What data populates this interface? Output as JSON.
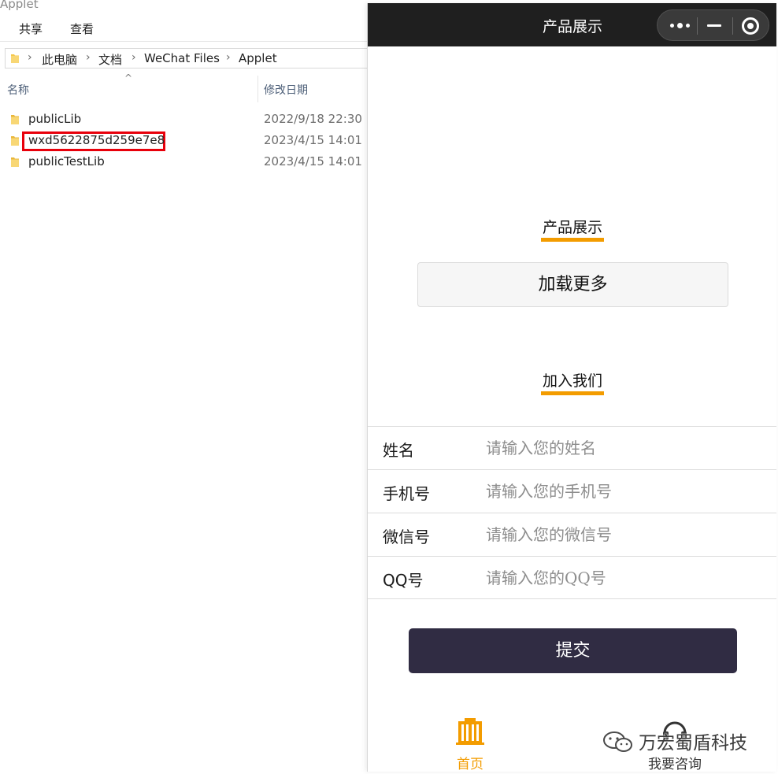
{
  "explorer": {
    "window_title": "Applet",
    "ribbon": [
      "共享",
      "查看"
    ],
    "breadcrumb": [
      "此电脑",
      "文档",
      "WeChat Files",
      "Applet"
    ],
    "columns": {
      "name": "名称",
      "date": "修改日期"
    },
    "files": [
      {
        "name": "publicLib",
        "date": "2022/9/18 22:30"
      },
      {
        "name": "wxd5622875d259e7e8",
        "date": "2023/4/15 14:01",
        "highlighted": true
      },
      {
        "name": "publicTestLib",
        "date": "2023/4/15 14:01"
      }
    ],
    "colors": {
      "folder": "#f5c84c",
      "highlight": "#e8000b"
    }
  },
  "miniapp": {
    "nav_title": "产品展示",
    "products_section": {
      "title": "产品展示",
      "load_more": "加载更多"
    },
    "join_section": {
      "title": "加入我们"
    },
    "form": [
      {
        "label": "姓名",
        "placeholder": "请输入您的姓名"
      },
      {
        "label": "手机号",
        "placeholder": "请输入您的手机号"
      },
      {
        "label": "微信号",
        "placeholder": "请输入您的微信号"
      },
      {
        "label": "QQ号",
        "placeholder": "请输入您的QQ号"
      }
    ],
    "submit_label": "提交",
    "tabs": [
      {
        "label": "首页",
        "icon": "building-icon",
        "active": true
      },
      {
        "label": "我要咨询",
        "icon": "headset-icon",
        "active": false
      }
    ],
    "colors": {
      "nav_bg": "#1f1f1f",
      "accent": "#f39c00",
      "submit_bg": "#302c43"
    }
  },
  "watermark": {
    "text": "万宏蜀盾科技"
  }
}
